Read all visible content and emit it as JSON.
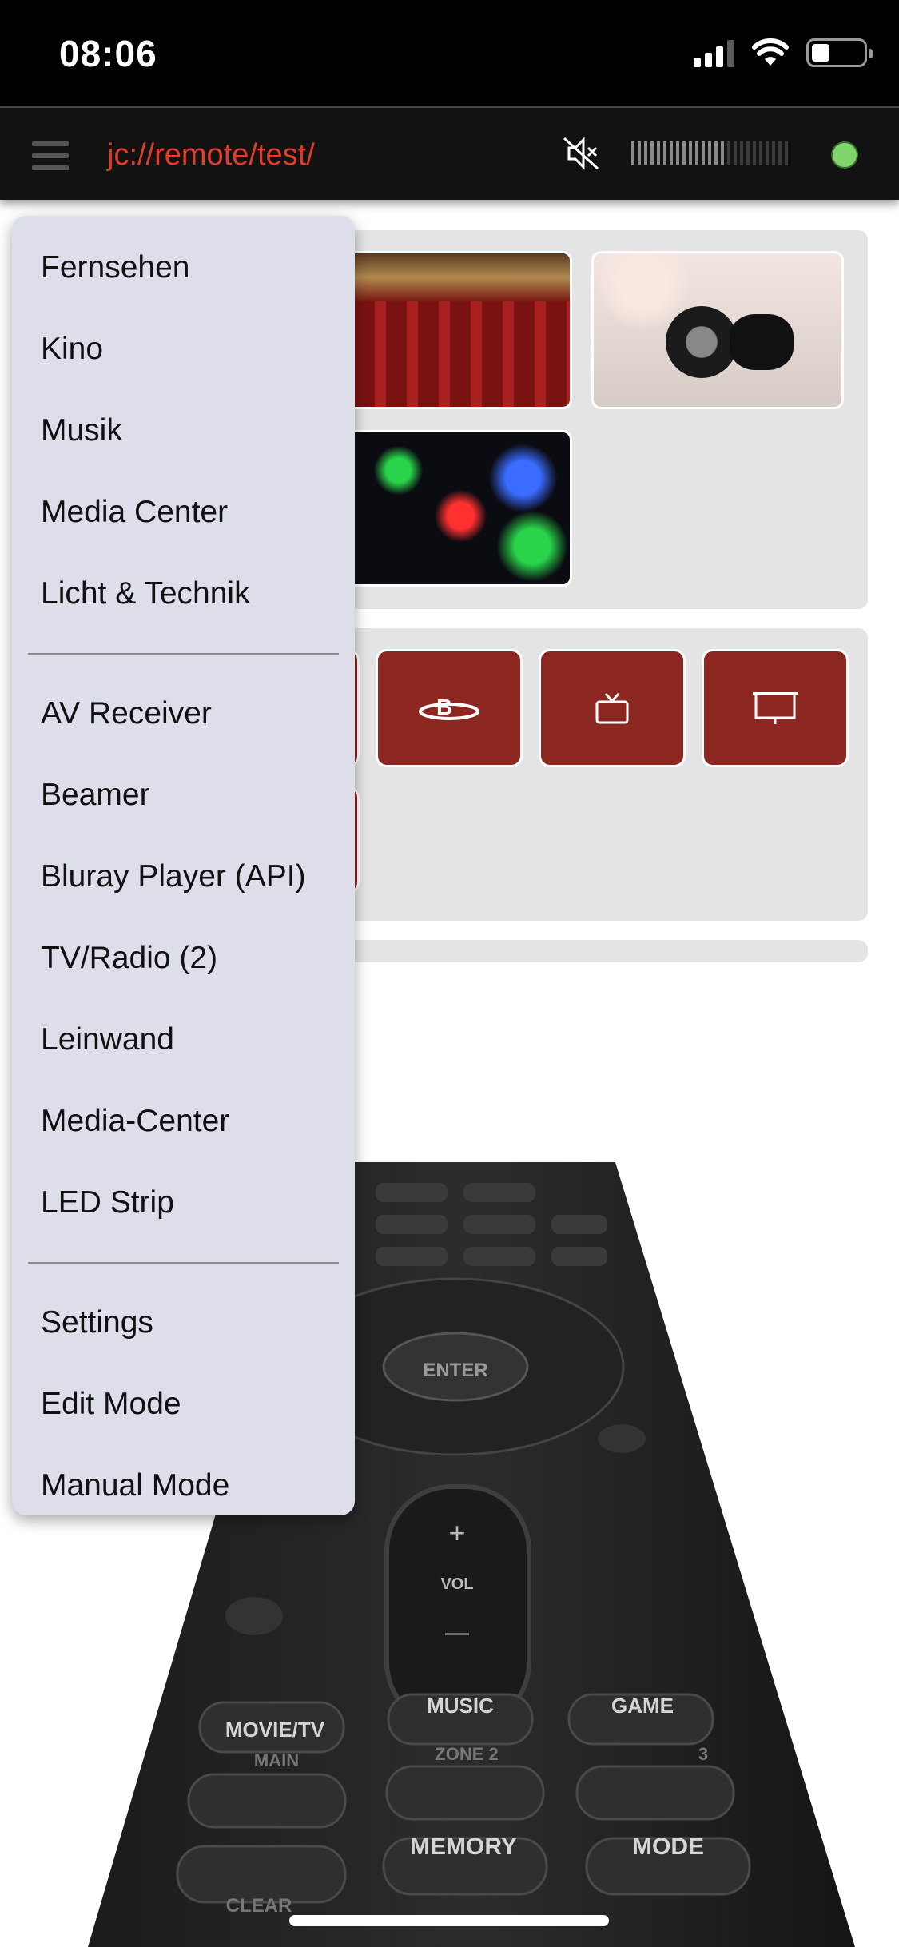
{
  "status_bar": {
    "time": "08:06"
  },
  "header": {
    "path": "jc://remote/test/",
    "mute_icon": "speaker-muted-icon",
    "connection_color": "#7fd46b",
    "accent": "#e03c2a"
  },
  "scenes": [
    {
      "name": "Kino",
      "image": "cinema-seats"
    },
    {
      "name": "Musik",
      "image": "headphones"
    },
    {
      "name": "Licht & Technik",
      "image": "led-strip"
    }
  ],
  "device_buttons": [
    {
      "icon": "bluray-icon"
    },
    {
      "icon": "tv-icon"
    },
    {
      "icon": "projector-screen-icon"
    }
  ],
  "remote_labels": {
    "enter": "ENTER",
    "vol": "VOL",
    "plus": "+",
    "minus": "—",
    "movie": "MOVIE/TV",
    "music": "MUSIC",
    "game": "GAME",
    "main": "MAIN",
    "zone2": "ZONE 2",
    "zone3": "3",
    "memory": "MEMORY",
    "mode": "MODE",
    "clear": "CLEAR"
  },
  "menu": {
    "scenes": [
      {
        "label": "Fernsehen"
      },
      {
        "label": "Kino"
      },
      {
        "label": "Musik"
      },
      {
        "label": "Media Center"
      },
      {
        "label": "Licht & Technik"
      }
    ],
    "devices": [
      {
        "label": "AV Receiver"
      },
      {
        "label": "Beamer"
      },
      {
        "label": "Bluray Player (API)"
      },
      {
        "label": "TV/Radio (2)"
      },
      {
        "label": "Leinwand"
      },
      {
        "label": "Media-Center"
      },
      {
        "label": "LED Strip"
      }
    ],
    "system": [
      {
        "label": "Settings"
      },
      {
        "label": "Edit Mode"
      },
      {
        "label": "Manual Mode"
      }
    ]
  },
  "colors": {
    "button_red": "#8b2620",
    "menu_bg": "#dedeea",
    "panel_bg": "#e4e4e4"
  },
  "volume_level": 0.6
}
